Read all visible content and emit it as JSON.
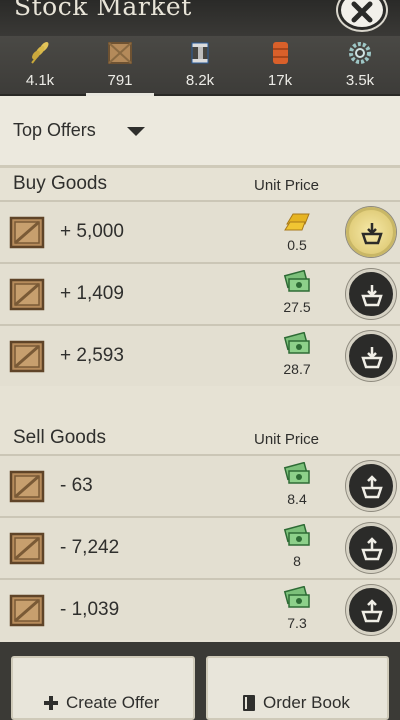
{
  "header": {
    "title": "Stock Market",
    "close_icon": "close-icon"
  },
  "resources": [
    {
      "icon": "wheat-icon",
      "value": "4.1k"
    },
    {
      "icon": "crate-icon",
      "value": "791"
    },
    {
      "icon": "steel-beam-icon",
      "value": "8.2k"
    },
    {
      "icon": "oil-barrel-icon",
      "value": "17k"
    },
    {
      "icon": "gear-icon",
      "value": "3.5k"
    }
  ],
  "filter": {
    "label": "Top Offers"
  },
  "buy": {
    "title": "Buy Goods",
    "unit_price_label": "Unit Price",
    "rows": [
      {
        "qty": "+ 5,000",
        "price": "0.5",
        "currency_icon": "gold-bar-icon"
      },
      {
        "qty": "+ 1,409",
        "price": "27.5",
        "currency_icon": "cash-icon"
      },
      {
        "qty": "+ 2,593",
        "price": "28.7",
        "currency_icon": "cash-icon"
      }
    ]
  },
  "sell": {
    "title": "Sell Goods",
    "unit_price_label": "Unit Price",
    "rows": [
      {
        "qty": "- 63",
        "price": "8.4",
        "currency_icon": "cash-icon"
      },
      {
        "qty": "- 7,242",
        "price": "8",
        "currency_icon": "cash-icon"
      },
      {
        "qty": "- 1,039",
        "price": "7.3",
        "currency_icon": "cash-icon"
      }
    ]
  },
  "footer": {
    "create_offer": "Create Offer",
    "order_book": "Order Book"
  }
}
